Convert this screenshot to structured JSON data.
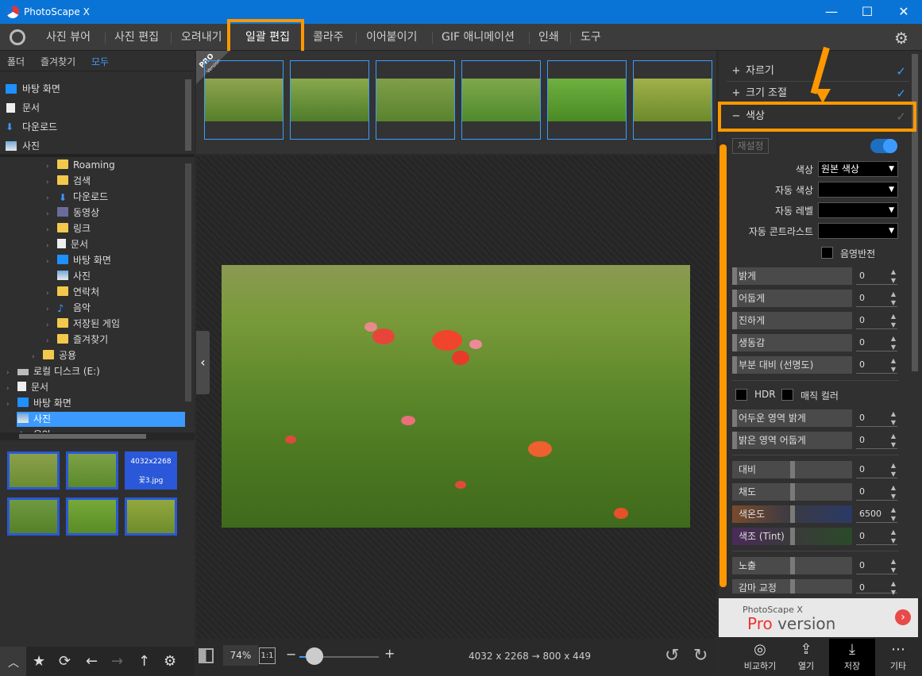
{
  "window": {
    "title": "PhotoScape X",
    "minimize": "—",
    "maximize": "☐",
    "close": "✕"
  },
  "menu": {
    "items": [
      "사진 뷰어",
      "사진 편집",
      "오려내기",
      "일괄 편집",
      "콜라주",
      "이어붙이기",
      "GIF 애니메이션",
      "인쇄",
      "도구"
    ],
    "active": "일괄 편집"
  },
  "left": {
    "tabs": [
      "폴더",
      "즐겨찾기",
      "모두"
    ],
    "favorites": [
      "바탕 화면",
      "문서",
      "다운로드",
      "사진"
    ],
    "tree": [
      "Roaming",
      "검색",
      "다운로드",
      "동영상",
      "링크",
      "문서",
      "바탕 화면",
      "사진",
      "연락처",
      "음악",
      "저장된 게임",
      "즐겨찾기",
      "공용",
      "로컬 디스크 (E:)",
      "문서",
      "바탕 화면",
      "사진",
      "음악"
    ],
    "selected_tree": "사진",
    "thumb_info": {
      "size": "4032x2268",
      "name": "꽃3.jpg"
    }
  },
  "filmstrip": {
    "pro_badge": "PRO",
    "pro_sub": "Version"
  },
  "bottom": {
    "zoom": "74%",
    "ratio_btn": "1:1",
    "zoom_level": 0.2,
    "size_info": "4032 x 2268 → 800 x 449"
  },
  "right": {
    "sections": [
      {
        "sign": "+",
        "label": "자르기",
        "checked": true
      },
      {
        "sign": "+",
        "label": "크기 조절",
        "checked": true
      },
      {
        "sign": "−",
        "label": "색상",
        "checked": false
      }
    ],
    "reset": "재설정",
    "color_label": "색상",
    "color_value": "원본 색상",
    "auto_color": "자동 색상",
    "auto_level": "자동 레벨",
    "auto_contrast": "자동 콘트라스트",
    "negative": "음영반전",
    "sliders1": [
      {
        "label": "밝게",
        "value": "0"
      },
      {
        "label": "어둡게",
        "value": "0"
      },
      {
        "label": "진하게",
        "value": "0"
      },
      {
        "label": "생동감",
        "value": "0"
      },
      {
        "label": "부분 대비 (선명도)",
        "value": "0"
      }
    ],
    "hdr": "HDR",
    "magic": "매직 컬러",
    "sliders2": [
      {
        "label": "어두운 영역 밝게",
        "value": "0"
      },
      {
        "label": "밝은 영역 어둡게",
        "value": "0"
      }
    ],
    "sliders3": [
      {
        "label": "대비",
        "value": "0"
      },
      {
        "label": "채도",
        "value": "0"
      },
      {
        "label": "색온도",
        "value": "6500"
      },
      {
        "label": "색조 (Tint)",
        "value": "0"
      }
    ],
    "sliders4": [
      {
        "label": "노출",
        "value": "0"
      },
      {
        "label": "감마 교정",
        "value": "0"
      }
    ],
    "banner": {
      "line1": "PhotoScape X",
      "line2a": "Pro",
      "line2b": " version"
    },
    "buttons": [
      "비교하기",
      "열기",
      "저장",
      "기타"
    ]
  },
  "colors": {
    "accent": "#3c9aff",
    "highlight": "#ff9800",
    "titlebar": "#0a74d6"
  }
}
